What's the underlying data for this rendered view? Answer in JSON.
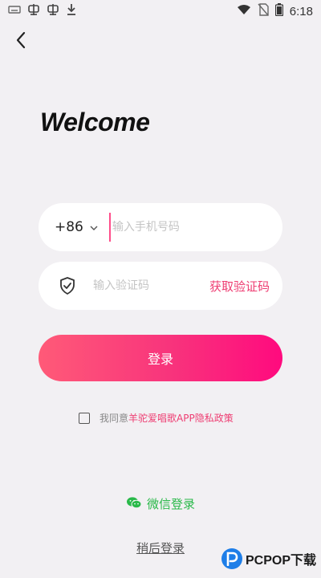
{
  "status_bar": {
    "time": "6:18",
    "left_icons": [
      "keyboard-icon",
      "notification-icon",
      "notification-icon",
      "download-icon"
    ],
    "right_icons": [
      "wifi-icon",
      "no-sim-icon",
      "battery-icon"
    ]
  },
  "header": {
    "back_icon": "chevron-left-icon"
  },
  "welcome": "Welcome",
  "phone": {
    "country_code": "+86",
    "placeholder": "输入手机号码",
    "value": ""
  },
  "code": {
    "icon": "shield-check-icon",
    "placeholder": "输入验证码",
    "value": "",
    "get_code_label": "获取验证码"
  },
  "login_button": "登录",
  "agreement": {
    "checked": false,
    "prefix": "我同意",
    "link": "羊驼爱唱歌APP隐私政策"
  },
  "wechat_login": {
    "icon": "wechat-icon",
    "label": "微信登录"
  },
  "later_login": "稍后登录",
  "watermark": {
    "text": "PCPOP下载"
  },
  "colors": {
    "accent": "#ee3d72",
    "gradient_start": "#ff5a78",
    "gradient_end": "#ff0a7e",
    "wechat_green": "#2ab94a",
    "background": "#f2f0f3"
  }
}
